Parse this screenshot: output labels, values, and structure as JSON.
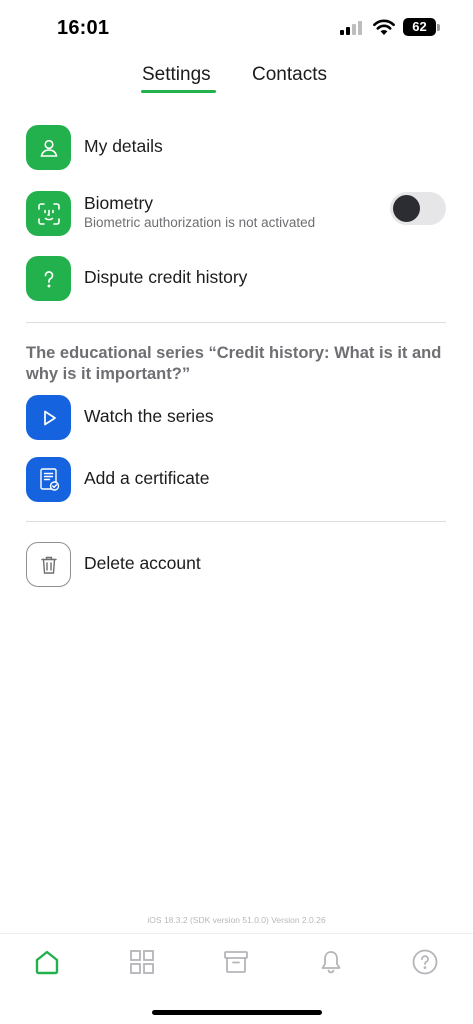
{
  "status_bar": {
    "time": "16:01",
    "battery": "62"
  },
  "tabs": [
    {
      "label": "Settings",
      "active": true
    },
    {
      "label": "Contacts",
      "active": false
    }
  ],
  "settings": {
    "my_details": {
      "label": "My details",
      "icon": "person-icon"
    },
    "biometry": {
      "label": "Biometry",
      "sublabel": "Biometric authorization is not activated",
      "icon": "face-id-icon",
      "enabled": false
    },
    "dispute": {
      "label": "Dispute credit history",
      "icon": "question-icon"
    }
  },
  "education": {
    "title": "The educational series “Credit history: What is it and why is it important?”",
    "watch": {
      "label": "Watch the series",
      "icon": "play-icon"
    },
    "certificate": {
      "label": "Add a certificate",
      "icon": "certificate-icon"
    }
  },
  "account": {
    "delete": {
      "label": "Delete account",
      "icon": "trash-icon"
    }
  },
  "version_text": "iOS 18.3.2 (SDK version 51.0.0) Version 2.0.26",
  "bottom_nav": [
    "home-icon",
    "grid-icon",
    "archive-icon",
    "bell-icon",
    "help-icon"
  ],
  "colors": {
    "accent_green": "#22b14c",
    "accent_blue": "#1663e0"
  }
}
